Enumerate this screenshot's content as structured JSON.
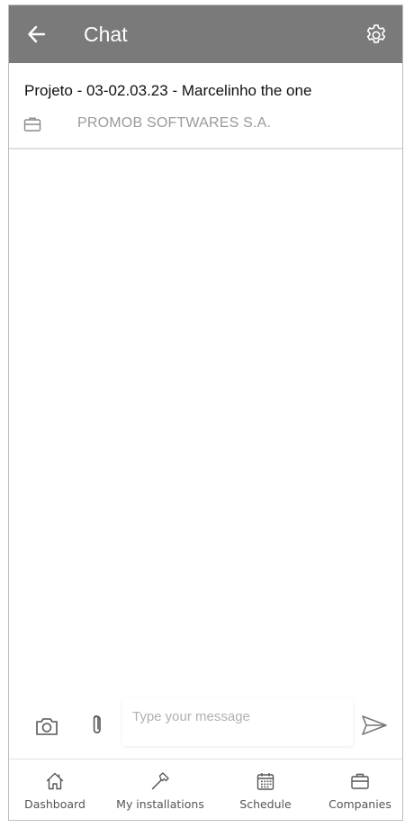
{
  "appbar": {
    "title": "Chat",
    "back_icon": "arrow-left-icon",
    "settings_icon": "gear-icon",
    "background": "#7a7a7a"
  },
  "project": {
    "title": "Projeto - 03-02.03.23 - Marcelinho the one",
    "company_icon": "briefcase-icon",
    "company": "PROMOB SOFTWARES S.A."
  },
  "composer": {
    "camera_icon": "camera-icon",
    "attach_icon": "paperclip-icon",
    "placeholder": "Type your message",
    "value": "",
    "send_icon": "send-icon"
  },
  "nav": {
    "items": [
      {
        "label": "Dashboard",
        "icon": "home-icon"
      },
      {
        "label": "My installations",
        "icon": "hammer-icon"
      },
      {
        "label": "Schedule",
        "icon": "calendar-icon"
      },
      {
        "label": "Companies",
        "icon": "briefcase-icon"
      }
    ]
  }
}
